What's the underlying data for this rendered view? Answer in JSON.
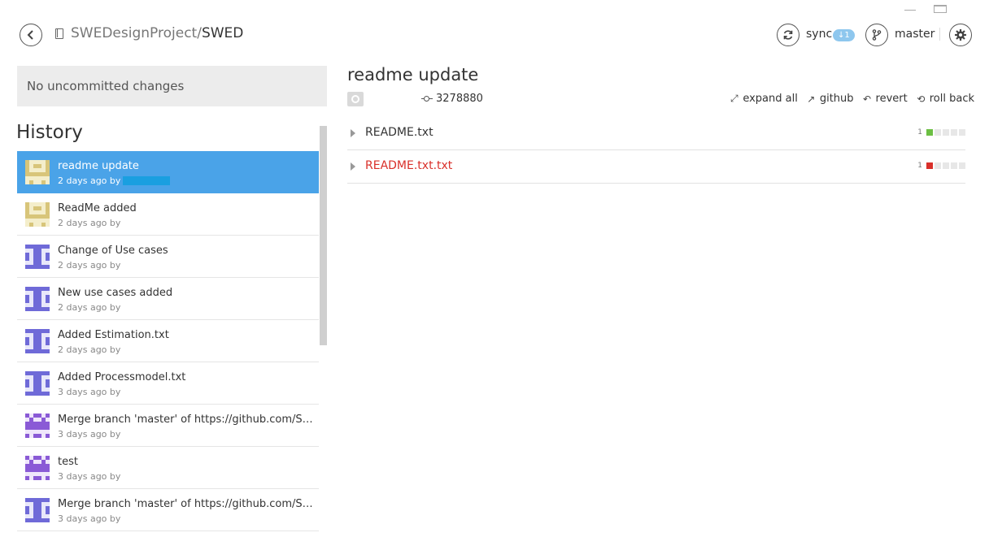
{
  "window": {
    "minimize_icon": "minimize-icon",
    "maximize_icon": "maximize-icon",
    "close_icon": "close-icon"
  },
  "header": {
    "repo_owner": "SWEDesignProject/",
    "repo_name": "SWED",
    "sync_label": "sync",
    "sync_badge": "↓1",
    "branch_label": "master"
  },
  "left": {
    "uncommitted": "No uncommitted changes",
    "history_title": "History",
    "commits": [
      {
        "title": "readme update",
        "meta": "2 days ago by",
        "avatar": "tan"
      },
      {
        "title": "ReadMe added",
        "meta": "2 days ago by",
        "avatar": "tan"
      },
      {
        "title": "Change of Use cases",
        "meta": "2 days ago by",
        "avatar": "blue"
      },
      {
        "title": "New use cases added",
        "meta": "2 days ago by",
        "avatar": "blue"
      },
      {
        "title": "Added Estimation.txt",
        "meta": "2 days ago by",
        "avatar": "blue"
      },
      {
        "title": "Added Processmodel.txt",
        "meta": "3 days ago by",
        "avatar": "blue"
      },
      {
        "title": "Merge branch 'master' of https://github.com/SWEDesignProject/SWED",
        "meta": "3 days ago by",
        "avatar": "purple"
      },
      {
        "title": "test",
        "meta": "3 days ago by",
        "avatar": "purple"
      },
      {
        "title": "Merge branch 'master' of https://github.com/SWEDesignProject/SWED",
        "meta": "3 days ago by",
        "avatar": "blue"
      }
    ]
  },
  "right": {
    "commit_title": "readme update",
    "sha": "3278880",
    "actions": {
      "expand_all": "expand all",
      "github": "github",
      "revert": "revert",
      "roll_back": "roll back"
    },
    "files": [
      {
        "name": "README.txt",
        "count": "1",
        "status": "added"
      },
      {
        "name": "README.txt.txt",
        "count": "1",
        "status": "deleted"
      }
    ]
  },
  "colors": {
    "accent": "#4aa3e8",
    "added": "#6cbf43",
    "deleted": "#d9302a",
    "avatar_tan": "#d8c57a",
    "avatar_blue": "#6f6ad8",
    "avatar_purple": "#8a5ad6"
  }
}
